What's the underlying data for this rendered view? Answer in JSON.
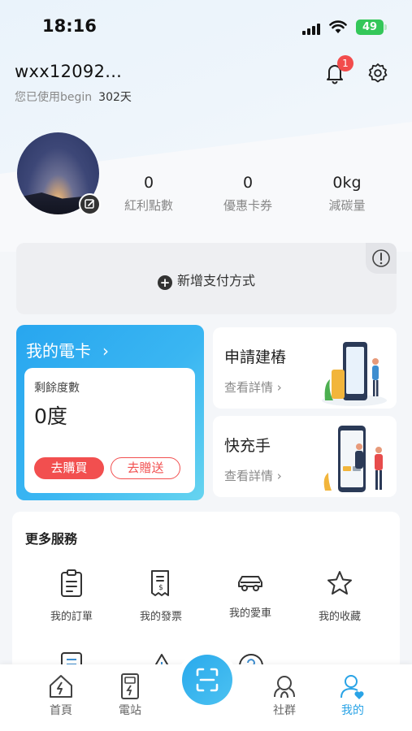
{
  "status_bar": {
    "time": "18:16",
    "battery": "49"
  },
  "profile": {
    "username": "wxx12092...",
    "usage_prefix": "您已使用begin",
    "usage_days": "302天",
    "notification_count": "1"
  },
  "stats": [
    {
      "value": "0",
      "label": "紅利點數"
    },
    {
      "value": "0",
      "label": "優惠卡券"
    },
    {
      "value": "0kg",
      "label": "減碳量"
    }
  ],
  "payment": {
    "add_label": "新增支付方式"
  },
  "my_card": {
    "title": "我的電卡",
    "remaining_label": "剩餘度數",
    "remaining_value": "0度",
    "buy_label": "去購買",
    "gift_label": "去贈送"
  },
  "side_cards": [
    {
      "title": "申請建樁",
      "detail": "查看詳情"
    },
    {
      "title": "快充手",
      "detail": "查看詳情"
    }
  ],
  "more_services": {
    "title": "更多服務",
    "items": [
      {
        "label": "我的訂單",
        "icon": "clipboard-icon"
      },
      {
        "label": "我的發票",
        "icon": "receipt-icon"
      },
      {
        "label": "我的愛車",
        "icon": "car-icon"
      },
      {
        "label": "我的收藏",
        "icon": "star-icon"
      }
    ]
  },
  "bottom_nav": {
    "items": [
      {
        "label": "首頁",
        "icon": "home-icon"
      },
      {
        "label": "電站",
        "icon": "charging-station-icon"
      },
      {
        "label": "社群",
        "icon": "community-icon"
      },
      {
        "label": "我的",
        "icon": "profile-icon"
      }
    ],
    "active": "我的"
  },
  "colors": {
    "accent": "#29a3e6",
    "danger": "#f24f4f"
  }
}
